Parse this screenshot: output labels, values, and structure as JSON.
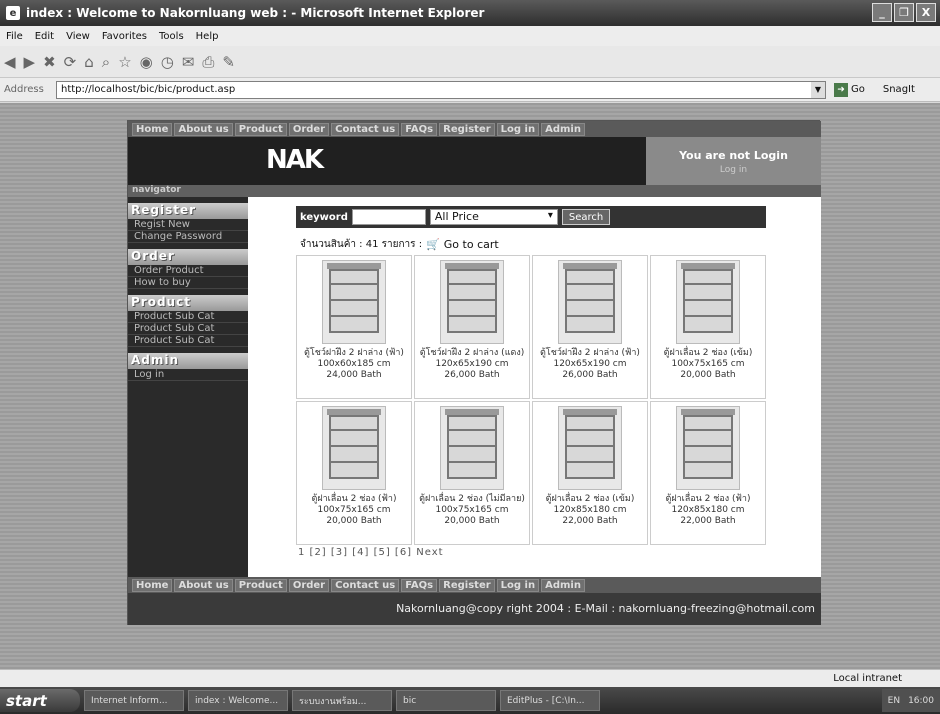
{
  "window": {
    "title": "index : Welcome to Nakornluang web : - Microsoft Internet Explorer",
    "controls": [
      "_",
      "❐",
      "X"
    ]
  },
  "menubar": [
    "File",
    "Edit",
    "View",
    "Favorites",
    "Tools",
    "Help"
  ],
  "address": {
    "label": "Address",
    "url": "http://localhost/bic/bic/product.asp",
    "go_label": "Go",
    "snagit_label": "SnagIt"
  },
  "site": {
    "topnav": [
      "Home",
      "About us",
      "Product",
      "Order",
      "Contact us",
      "FAQs",
      "Register",
      "Log in",
      "Admin"
    ],
    "logo": "NAK",
    "login_title": "You are not Login",
    "login_link": "Log in",
    "navigator_label": "navigator",
    "sidebar": [
      {
        "heading": "Register",
        "items": [
          "Regist New",
          "Change Password"
        ]
      },
      {
        "heading": "Order",
        "items": [
          "Order Product",
          "How to buy"
        ]
      },
      {
        "heading": "Product",
        "items": [
          "Product Sub Cat",
          "Product Sub Cat",
          "Product Sub Cat"
        ]
      },
      {
        "heading": "Admin",
        "items": [
          "Log in"
        ]
      }
    ],
    "search": {
      "keyword_label": "keyword",
      "keyword_value": "",
      "price_selected": "All Price",
      "button": "Search"
    },
    "count_text": "จำนวนสินค้า : 41 รายการ :",
    "cart_label": "Go to cart",
    "products": [
      {
        "name": "ตู้โชว์ฝาฝึง 2 ฝาล่าง (ฟ้า)",
        "size": "100x60x185 cm",
        "price": "24,000 Bath"
      },
      {
        "name": "ตู้โชว์ฝาฝึง 2 ฝาล่าง (แดง)",
        "size": "120x65x190 cm",
        "price": "26,000 Bath"
      },
      {
        "name": "ตู้โชว์ฝาฝึง 2 ฝาล่าง (ฟ้า)",
        "size": "120x65x190 cm",
        "price": "26,000 Bath"
      },
      {
        "name": "ตู้ฝาเลื่อน 2 ช่อง (เข้ม)",
        "size": "100x75x165 cm",
        "price": "20,000 Bath"
      },
      {
        "name": "ตู้ฝาเลื่อน 2 ช่อง (ฟ้า)",
        "size": "100x75x165 cm",
        "price": "20,000 Bath"
      },
      {
        "name": "ตู้ฝาเลื่อน 2 ช่อง (ไม่มีลาย)",
        "size": "100x75x165 cm",
        "price": "20,000 Bath"
      },
      {
        "name": "ตู้ฝาเลื่อน 2 ช่อง (เข้ม)",
        "size": "120x85x180 cm",
        "price": "22,000 Bath"
      },
      {
        "name": "ตู้ฝาเลื่อน 2 ช่อง (ฟ้า)",
        "size": "120x85x180 cm",
        "price": "22,000 Bath"
      }
    ],
    "pager": "1 [2] [3] [4] [5] [6] Next",
    "bottomnav": [
      "Home",
      "About us",
      "Product",
      "Order",
      "Contact us",
      "FAQs",
      "Register",
      "Log in",
      "Admin"
    ],
    "footer": "Nakornluang@copy right 2004 : E-Mail : nakornluang-freezing@hotmail.com"
  },
  "statusbar": {
    "zone": "Local intranet"
  },
  "taskbar": {
    "start": "start",
    "tasks": [
      "Internet Inform...",
      "index : Welcome...",
      "ระบบงานพร้อม...",
      "bic",
      "EditPlus - [C:\\In..."
    ],
    "lang": "EN",
    "time": "16:00"
  }
}
